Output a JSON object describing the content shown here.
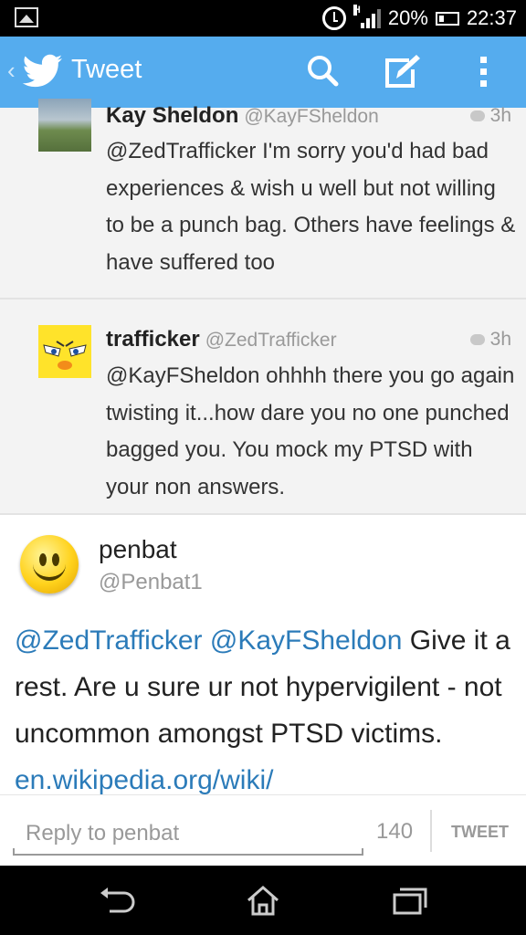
{
  "status_bar": {
    "network_type": "H",
    "battery": "20%",
    "time": "22:37"
  },
  "action_bar": {
    "title": "Tweet",
    "icons": [
      "twitter-bird-icon",
      "search-icon",
      "compose-icon",
      "overflow-menu-icon"
    ]
  },
  "tweets": [
    {
      "name": "Kay Sheldon",
      "handle": "@KayFSheldon",
      "time": "3h",
      "text": "@ZedTrafficker I'm sorry you'd had bad experiences & wish u well but not willing to be a punch bag. Others have feelings & have suffered too"
    },
    {
      "name": "trafficker",
      "handle": "@ZedTrafficker",
      "time": "3h",
      "text": "@KayFSheldon ohhhh there you go again twisting it...how dare you no one punched bagged you. You mock my PTSD with your non answers."
    }
  ],
  "detail": {
    "name": "penbat",
    "handle": "@Penbat1",
    "mention1": "@ZedTrafficker",
    "mention2": "@KayFSheldon",
    "text": " Give it a rest. Are u sure ur not hypervigilent - not uncommon amongst PTSD victims. ",
    "link": "en.wikipedia.org/wiki/"
  },
  "reply": {
    "placeholder": "Reply to penbat",
    "char_count": "140",
    "tweet_button": "TWEET"
  },
  "colors": {
    "accent": "#55acee",
    "link": "#2b7bb9"
  }
}
